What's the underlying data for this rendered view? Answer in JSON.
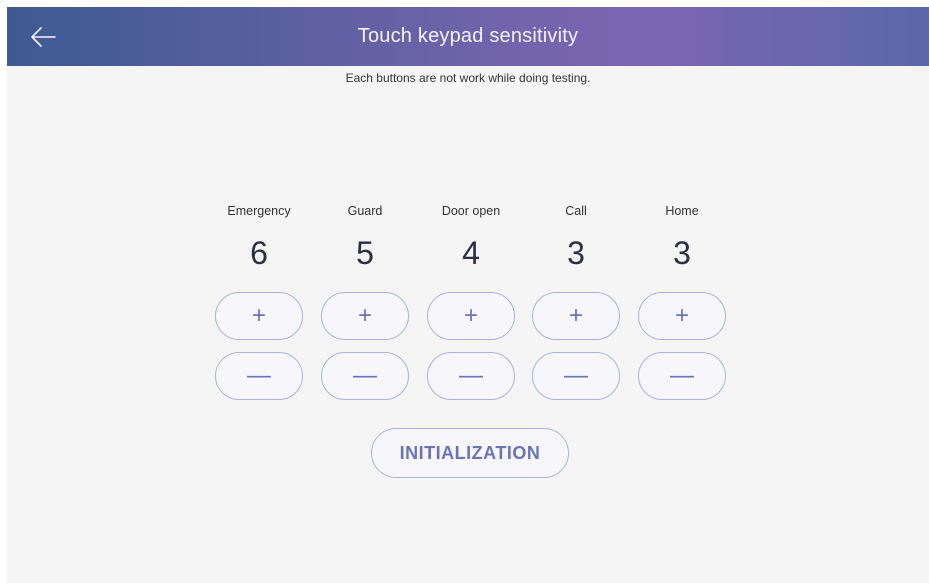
{
  "header": {
    "title": "Touch keypad sensitivity",
    "back_icon": "arrow-left-icon"
  },
  "notice": "Each buttons are not work while doing testing.",
  "keys": [
    {
      "label": "Emergency",
      "value": "6",
      "plus": "+",
      "minus": "—"
    },
    {
      "label": "Guard",
      "value": "5",
      "plus": "+",
      "minus": "—"
    },
    {
      "label": "Door open",
      "value": "4",
      "plus": "+",
      "minus": "—"
    },
    {
      "label": "Call",
      "value": "3",
      "plus": "+",
      "minus": "—"
    },
    {
      "label": "Home",
      "value": "3",
      "plus": "+",
      "minus": "—"
    }
  ],
  "initialization_label": "INITIALIZATION",
  "colors": {
    "header_start": "#3d5a93",
    "header_mid": "#7c66b3",
    "accent": "#6a73b8",
    "border": "#aab2e1",
    "background": "#f5f5f6"
  }
}
